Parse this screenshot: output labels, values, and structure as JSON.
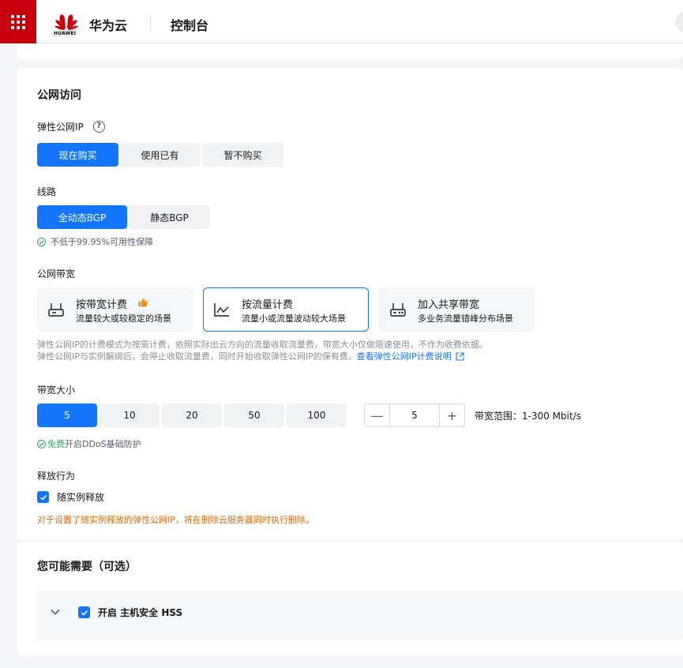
{
  "topbar": {
    "logo_text": "HUAWEI",
    "brand": "华为云",
    "console": "控制台"
  },
  "public_access": {
    "title": "公网访问",
    "eip": {
      "label": "弹性公网IP",
      "help": "?",
      "options": [
        "现在购买",
        "使用已有",
        "暂不购买"
      ],
      "selected": "现在购买"
    },
    "line": {
      "label": "线路",
      "options": [
        "全动态BGP",
        "静态BGP"
      ],
      "selected": "全动态BGP",
      "tip": "不低于99.95%可用性保障"
    },
    "bandwidth": {
      "label": "公网带宽",
      "options": [
        {
          "title": "按带宽计费",
          "sub": "流量较大或较稳定的场景",
          "icon": "router-icon",
          "recommended": true
        },
        {
          "title": "按流量计费",
          "sub": "流量小或流量波动较大场景",
          "icon": "line-chart-icon",
          "selected": true
        },
        {
          "title": "加入共享带宽",
          "sub": "多业务流量错峰分布场景",
          "icon": "shared-router-icon"
        }
      ],
      "desc_line1": "弹性公网IP的计费模式为按需计费，依照实际出云方向的流量收取流量费，带宽大小仅做限速使用，不作为收费依据。",
      "desc_line2": "弹性公网IP与实例解绑后，会停止收取流量费，同时开始收取弹性公网IP的保有费。",
      "desc_link": "查看弹性公网IP计费说明"
    },
    "size": {
      "label": "带宽大小",
      "options": [
        "5",
        "10",
        "20",
        "50",
        "100"
      ],
      "selected": "5",
      "stepper_value": "5",
      "minus": "—",
      "plus": "+",
      "range": "带宽范围：1-300 Mbit/s",
      "ddos_free": "免费",
      "ddos_text": "开启DDoS基础防护"
    },
    "release": {
      "label": "释放行为",
      "checkbox_label": "随实例释放",
      "checked": true,
      "warning": "对于设置了随实例释放的弹性公网IP，将在删除云服务器同时执行删除。"
    }
  },
  "optional": {
    "title": "您可能需要（可选）",
    "hss_label": "开启 主机安全 HSS",
    "hss_checked": true
  },
  "colors": {
    "primary": "#1476ff",
    "brand_red": "#c7000b",
    "success": "#2ea865",
    "warning": "#e56a00",
    "recommend": "#ff8800"
  }
}
